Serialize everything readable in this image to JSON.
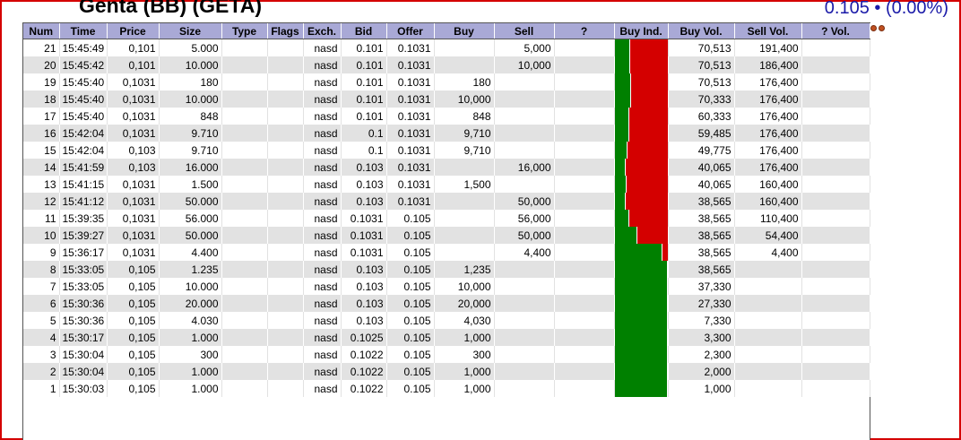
{
  "header": {
    "title": "Genta (BB) (GETA)",
    "quote": "0.105 • (0.00%)"
  },
  "columns": [
    "Num",
    "Time",
    "Price",
    "Size",
    "Type",
    "Flags",
    "Exch.",
    "Bid",
    "Offer",
    "Buy",
    "Sell",
    "?",
    "Buy Ind.",
    "Buy Vol.",
    "Sell Vol.",
    "? Vol."
  ],
  "colors": {
    "header_bg": "#a9a9d6",
    "stripe": "#e2e2e2",
    "buy": "#008000",
    "sell": "#d40000",
    "quote": "#1a1aa8",
    "frame": "#d40000"
  },
  "rows": [
    {
      "num": "21",
      "time": "15:45:49",
      "price": "0,101",
      "size": "5.000",
      "type": "",
      "flags": "",
      "exch": "nasd",
      "bid": "0.101",
      "offer": "0.1031",
      "buy": "",
      "sell": "5,000",
      "q": "",
      "buy_ratio": 0.269,
      "buy_vol": "70,513",
      "sell_vol": "191,400",
      "q_vol": ""
    },
    {
      "num": "20",
      "time": "15:45:42",
      "price": "0,101",
      "size": "10.000",
      "type": "",
      "flags": "",
      "exch": "nasd",
      "bid": "0.101",
      "offer": "0.1031",
      "buy": "",
      "sell": "10,000",
      "q": "",
      "buy_ratio": 0.275,
      "buy_vol": "70,513",
      "sell_vol": "186,400",
      "q_vol": ""
    },
    {
      "num": "19",
      "time": "15:45:40",
      "price": "0,1031",
      "size": "180",
      "type": "",
      "flags": "",
      "exch": "nasd",
      "bid": "0.101",
      "offer": "0.1031",
      "buy": "180",
      "sell": "",
      "q": "",
      "buy_ratio": 0.286,
      "buy_vol": "70,513",
      "sell_vol": "176,400",
      "q_vol": ""
    },
    {
      "num": "18",
      "time": "15:45:40",
      "price": "0,1031",
      "size": "10.000",
      "type": "",
      "flags": "",
      "exch": "nasd",
      "bid": "0.101",
      "offer": "0.1031",
      "buy": "10,000",
      "sell": "",
      "q": "",
      "buy_ratio": 0.285,
      "buy_vol": "70,333",
      "sell_vol": "176,400",
      "q_vol": ""
    },
    {
      "num": "17",
      "time": "15:45:40",
      "price": "0,1031",
      "size": "848",
      "type": "",
      "flags": "",
      "exch": "nasd",
      "bid": "0.101",
      "offer": "0.1031",
      "buy": "848",
      "sell": "",
      "q": "",
      "buy_ratio": 0.255,
      "buy_vol": "60,333",
      "sell_vol": "176,400",
      "q_vol": ""
    },
    {
      "num": "16",
      "time": "15:42:04",
      "price": "0,1031",
      "size": "9.710",
      "type": "",
      "flags": "",
      "exch": "nasd",
      "bid": "0.1",
      "offer": "0.1031",
      "buy": "9,710",
      "sell": "",
      "q": "",
      "buy_ratio": 0.252,
      "buy_vol": "59,485",
      "sell_vol": "176,400",
      "q_vol": ""
    },
    {
      "num": "15",
      "time": "15:42:04",
      "price": "0,103",
      "size": "9.710",
      "type": "",
      "flags": "",
      "exch": "nasd",
      "bid": "0.1",
      "offer": "0.1031",
      "buy": "9,710",
      "sell": "",
      "q": "",
      "buy_ratio": 0.22,
      "buy_vol": "49,775",
      "sell_vol": "176,400",
      "q_vol": ""
    },
    {
      "num": "14",
      "time": "15:41:59",
      "price": "0,103",
      "size": "16.000",
      "type": "",
      "flags": "",
      "exch": "nasd",
      "bid": "0.103",
      "offer": "0.1031",
      "buy": "",
      "sell": "16,000",
      "q": "",
      "buy_ratio": 0.185,
      "buy_vol": "40,065",
      "sell_vol": "176,400",
      "q_vol": ""
    },
    {
      "num": "13",
      "time": "15:41:15",
      "price": "0,1031",
      "size": "1.500",
      "type": "",
      "flags": "",
      "exch": "nasd",
      "bid": "0.103",
      "offer": "0.1031",
      "buy": "1,500",
      "sell": "",
      "q": "",
      "buy_ratio": 0.2,
      "buy_vol": "40,065",
      "sell_vol": "160,400",
      "q_vol": ""
    },
    {
      "num": "12",
      "time": "15:41:12",
      "price": "0,1031",
      "size": "50.000",
      "type": "",
      "flags": "",
      "exch": "nasd",
      "bid": "0.103",
      "offer": "0.1031",
      "buy": "",
      "sell": "50,000",
      "q": "",
      "buy_ratio": 0.194,
      "buy_vol": "38,565",
      "sell_vol": "160,400",
      "q_vol": ""
    },
    {
      "num": "11",
      "time": "15:39:35",
      "price": "0,1031",
      "size": "56.000",
      "type": "",
      "flags": "",
      "exch": "nasd",
      "bid": "0.1031",
      "offer": "0.105",
      "buy": "",
      "sell": "56,000",
      "q": "",
      "buy_ratio": 0.259,
      "buy_vol": "38,565",
      "sell_vol": "110,400",
      "q_vol": ""
    },
    {
      "num": "10",
      "time": "15:39:27",
      "price": "0,1031",
      "size": "50.000",
      "type": "",
      "flags": "",
      "exch": "nasd",
      "bid": "0.1031",
      "offer": "0.105",
      "buy": "",
      "sell": "50,000",
      "q": "",
      "buy_ratio": 0.415,
      "buy_vol": "38,565",
      "sell_vol": "54,400",
      "q_vol": ""
    },
    {
      "num": "9",
      "time": "15:36:17",
      "price": "0,1031",
      "size": "4.400",
      "type": "",
      "flags": "",
      "exch": "nasd",
      "bid": "0.1031",
      "offer": "0.105",
      "buy": "",
      "sell": "4,400",
      "q": "",
      "buy_ratio": 0.898,
      "buy_vol": "38,565",
      "sell_vol": "4,400",
      "q_vol": ""
    },
    {
      "num": "8",
      "time": "15:33:05",
      "price": "0,105",
      "size": "1.235",
      "type": "",
      "flags": "",
      "exch": "nasd",
      "bid": "0.103",
      "offer": "0.105",
      "buy": "1,235",
      "sell": "",
      "q": "",
      "buy_ratio": 1,
      "buy_vol": "38,565",
      "sell_vol": "",
      "q_vol": ""
    },
    {
      "num": "7",
      "time": "15:33:05",
      "price": "0,105",
      "size": "10.000",
      "type": "",
      "flags": "",
      "exch": "nasd",
      "bid": "0.103",
      "offer": "0.105",
      "buy": "10,000",
      "sell": "",
      "q": "",
      "buy_ratio": 1,
      "buy_vol": "37,330",
      "sell_vol": "",
      "q_vol": ""
    },
    {
      "num": "6",
      "time": "15:30:36",
      "price": "0,105",
      "size": "20.000",
      "type": "",
      "flags": "",
      "exch": "nasd",
      "bid": "0.103",
      "offer": "0.105",
      "buy": "20,000",
      "sell": "",
      "q": "",
      "buy_ratio": 1,
      "buy_vol": "27,330",
      "sell_vol": "",
      "q_vol": ""
    },
    {
      "num": "5",
      "time": "15:30:36",
      "price": "0,105",
      "size": "4.030",
      "type": "",
      "flags": "",
      "exch": "nasd",
      "bid": "0.103",
      "offer": "0.105",
      "buy": "4,030",
      "sell": "",
      "q": "",
      "buy_ratio": 1,
      "buy_vol": "7,330",
      "sell_vol": "",
      "q_vol": ""
    },
    {
      "num": "4",
      "time": "15:30:17",
      "price": "0,105",
      "size": "1.000",
      "type": "",
      "flags": "",
      "exch": "nasd",
      "bid": "0.1025",
      "offer": "0.105",
      "buy": "1,000",
      "sell": "",
      "q": "",
      "buy_ratio": 1,
      "buy_vol": "3,300",
      "sell_vol": "",
      "q_vol": ""
    },
    {
      "num": "3",
      "time": "15:30:04",
      "price": "0,105",
      "size": "300",
      "type": "",
      "flags": "",
      "exch": "nasd",
      "bid": "0.1022",
      "offer": "0.105",
      "buy": "300",
      "sell": "",
      "q": "",
      "buy_ratio": 1,
      "buy_vol": "2,300",
      "sell_vol": "",
      "q_vol": ""
    },
    {
      "num": "2",
      "time": "15:30:04",
      "price": "0,105",
      "size": "1.000",
      "type": "",
      "flags": "",
      "exch": "nasd",
      "bid": "0.1022",
      "offer": "0.105",
      "buy": "1,000",
      "sell": "",
      "q": "",
      "buy_ratio": 1,
      "buy_vol": "2,000",
      "sell_vol": "",
      "q_vol": ""
    },
    {
      "num": "1",
      "time": "15:30:03",
      "price": "0,105",
      "size": "1.000",
      "type": "",
      "flags": "",
      "exch": "nasd",
      "bid": "0.1022",
      "offer": "0.105",
      "buy": "1,000",
      "sell": "",
      "q": "",
      "buy_ratio": 1,
      "buy_vol": "1,000",
      "sell_vol": "",
      "q_vol": ""
    }
  ]
}
